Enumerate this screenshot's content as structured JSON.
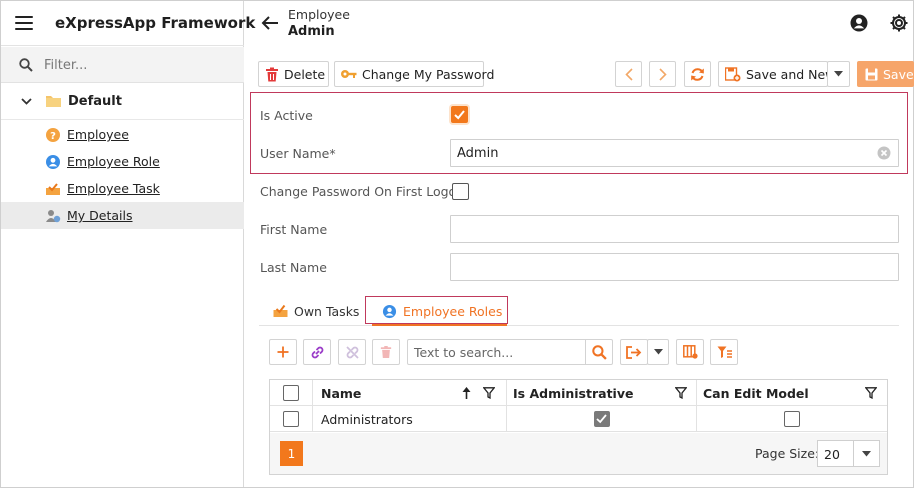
{
  "app": {
    "title": "eXpressApp Framework"
  },
  "sidebar": {
    "filter_placeholder": "Filter...",
    "group_label": "Default",
    "items": [
      {
        "label": "Employee",
        "icon": "employee-icon"
      },
      {
        "label": "Employee Role",
        "icon": "employee-role-icon"
      },
      {
        "label": "Employee Task",
        "icon": "employee-task-icon"
      },
      {
        "label": "My Details",
        "icon": "my-details-icon",
        "selected": true
      }
    ]
  },
  "header": {
    "breadcrumb_parent": "Employee",
    "breadcrumb_current": "Admin"
  },
  "toolbar": {
    "delete_label": "Delete",
    "change_password_label": "Change My Password",
    "save_and_new_label": "Save and New",
    "save_label": "Save"
  },
  "form": {
    "is_active_label": "Is Active",
    "is_active": true,
    "user_name_label": "User Name*",
    "user_name_value": "Admin",
    "change_password_label": "Change Password On First Logon",
    "change_password_checked": false,
    "first_name_label": "First Name",
    "first_name_value": "",
    "last_name_label": "Last Name",
    "last_name_value": ""
  },
  "tabs": [
    {
      "label": "Own Tasks",
      "active": false
    },
    {
      "label": "Employee Roles",
      "active": true
    }
  ],
  "grid": {
    "search_placeholder": "Text to search...",
    "columns": [
      "Name",
      "Is Administrative",
      "Can Edit Model"
    ],
    "rows": [
      {
        "name": "Administrators",
        "is_administrative": true,
        "can_edit_model": false
      }
    ],
    "current_page": "1",
    "page_size_label": "Page Size:",
    "page_size": "20"
  },
  "colors": {
    "accent": "#f2781c",
    "highlight_border": "#c0395c",
    "save_button": "#f6a56a"
  }
}
